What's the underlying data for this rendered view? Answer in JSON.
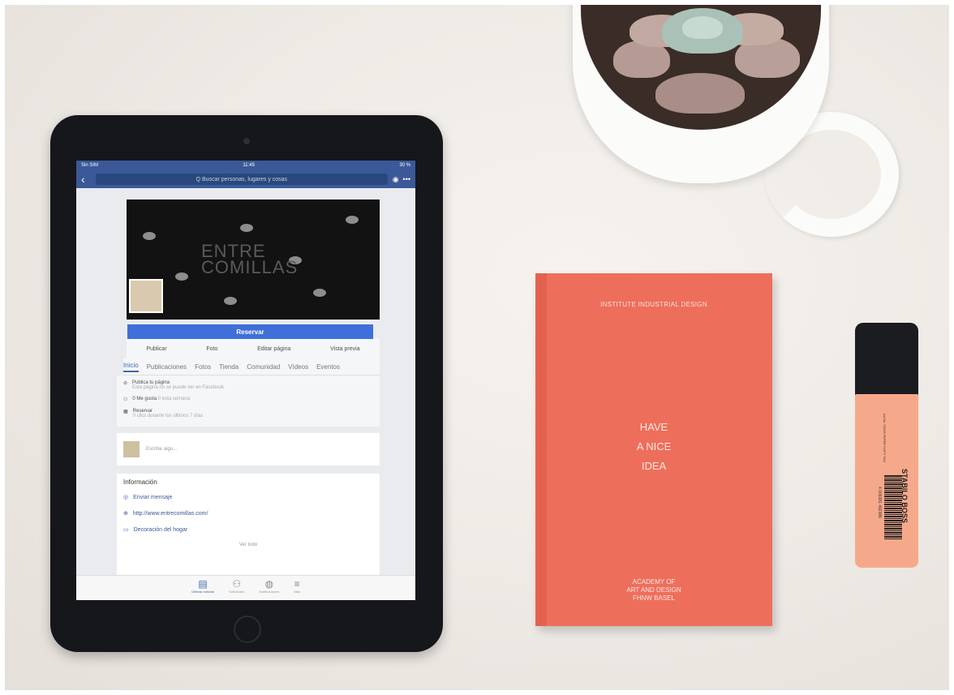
{
  "ipad_screen": {
    "status": {
      "carrier": "Sin SIM",
      "time": "11:45",
      "battery": "30 %"
    },
    "search_placeholder": "Q Buscar personas, lugares y cosas",
    "cover_text": {
      "line1": "ENTRE",
      "line2": "COMILLAS"
    },
    "cta_label": "Reservar",
    "actions": [
      "Publicar",
      "Foto",
      "Editar página",
      "Vista previa"
    ],
    "tabs": [
      "Inicio",
      "Publicaciones",
      "Fotos",
      "Tienda",
      "Comunidad",
      "Vídeos",
      "Eventos"
    ],
    "rows": [
      {
        "title": "Publica tu página",
        "sub": "Esta página no se puede ver en Facebook"
      },
      {
        "title": "0 Me gusta",
        "sub": "0 esta semana"
      },
      {
        "title": "Reservar",
        "sub": "0 clics durante los últimos 7 días"
      }
    ],
    "composer_placeholder": "Escribe algo...",
    "info_title": "Información",
    "info_links": [
      "Enviar mensaje",
      "http://www.entrecomillas.com/",
      "Decoración del hogar"
    ],
    "see_all": "Ver todo",
    "tabbar": [
      "Últimas noticias",
      "Solicitudes",
      "Notificaciones",
      "Más"
    ]
  },
  "book": {
    "top": "INSTITUTE INDUSTRIAL DESIGN",
    "middle": [
      "HAVE",
      "A NICE",
      "IDEA"
    ],
    "bottom": [
      "ACADEMY OF",
      "ART AND DESIGN",
      "FHNW BASEL"
    ]
  },
  "highlighter": {
    "brand": "STABILO BOSS",
    "small": "Art.No.70/125 PAPER COPY FAX",
    "barcode": "4 006381 492386"
  }
}
